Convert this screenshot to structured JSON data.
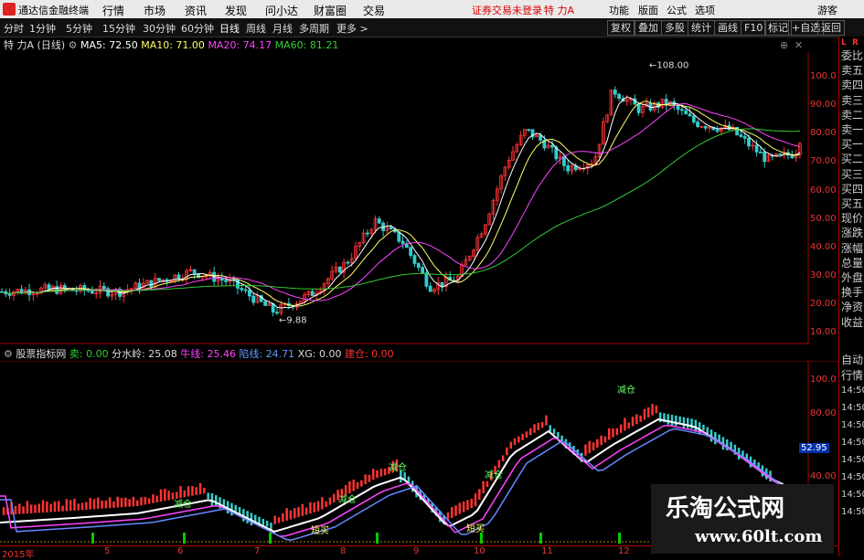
{
  "titlebar": {
    "app_name": "通达信金融终端",
    "menu": [
      "行情",
      "市场",
      "资讯",
      "发现",
      "问小达",
      "财富圈",
      "交易"
    ],
    "warning": "证券交易未登录",
    "stock": "特 力A",
    "right_menu": [
      "功能",
      "版面",
      "公式",
      "选项"
    ],
    "user": "游客"
  },
  "periodbar": {
    "periods": [
      "分时",
      "1分钟",
      "5分钟",
      "15分钟",
      "30分钟",
      "60分钟",
      "日线",
      "周线",
      "月线",
      "多周期",
      "更多 >"
    ],
    "active": "日线",
    "tools": [
      "复权",
      "叠加",
      "多股",
      "统计",
      "画线",
      "F10",
      "标记",
      "+自选",
      "返回"
    ]
  },
  "main_legend": {
    "name": "特 力A",
    "period": "(日线)",
    "ma5": "MA5: 72.50",
    "ma10": "MA10: 71.00",
    "ma20": "MA20: 74.17",
    "ma60": "MA60: 81.21"
  },
  "main_axis": [
    "100.0",
    "90.00",
    "80.00",
    "70.00",
    "60.00",
    "50.00",
    "40.00",
    "30.00",
    "20.00",
    "10.00"
  ],
  "annotations": {
    "high": "108.00",
    "low": "9.88"
  },
  "indicator_legend": {
    "name": "股票指标网",
    "sell": "卖: 0.00",
    "water": "分水岭: 25.08",
    "bull": "牛线: 25.46",
    "trap": "陷线: 24.71",
    "xg": "XG: 0.00",
    "pos": "建仓: 0.00"
  },
  "indicator_axis": [
    "100.0",
    "80.00",
    "40.00"
  ],
  "indicator_value": "52.95",
  "time_labels": [
    "14:50",
    "14:50",
    "14:50",
    "14:50",
    "14:50",
    "14:50",
    "14:50",
    "14:50"
  ],
  "xaxis": [
    "2015年",
    "5",
    "6",
    "7",
    "8",
    "9",
    "10",
    "11",
    "12"
  ],
  "sidepanel": {
    "top": [
      "委比",
      "卖五",
      "卖四",
      "卖三",
      "卖二",
      "卖一",
      "买一",
      "买二",
      "买三",
      "买四",
      "买五",
      "现价",
      "涨跌",
      "涨幅",
      "总量",
      "外盘",
      "换手",
      "净资",
      "收益"
    ],
    "bottom": [
      "自动",
      "行情"
    ]
  },
  "markers": {
    "buy": "短买",
    "warn": "减仓"
  },
  "watermark": {
    "cn": "乐淘公式网",
    "url": "www.60lt.com"
  },
  "colors": {
    "up": "#ff3333",
    "down": "#33cccc",
    "ma5": "#ffffff",
    "ma10": "#ffff66",
    "ma20": "#ff44ff",
    "ma60": "#33cc33"
  },
  "chart_data": {
    "type": "candlestick",
    "ylim": [
      0,
      110
    ],
    "x": [
      "2015-04",
      "2015-05",
      "2015-06",
      "2015-07",
      "2015-08",
      "2015-09",
      "2015-10",
      "2015-11",
      "2015-12"
    ],
    "close": [
      20,
      21,
      26,
      15,
      44,
      23,
      72,
      93,
      76
    ],
    "high": [
      22,
      23,
      31,
      18,
      50,
      30,
      90,
      108,
      95
    ],
    "low": [
      17,
      18,
      22,
      9.88,
      30,
      18,
      60,
      75,
      67
    ]
  }
}
